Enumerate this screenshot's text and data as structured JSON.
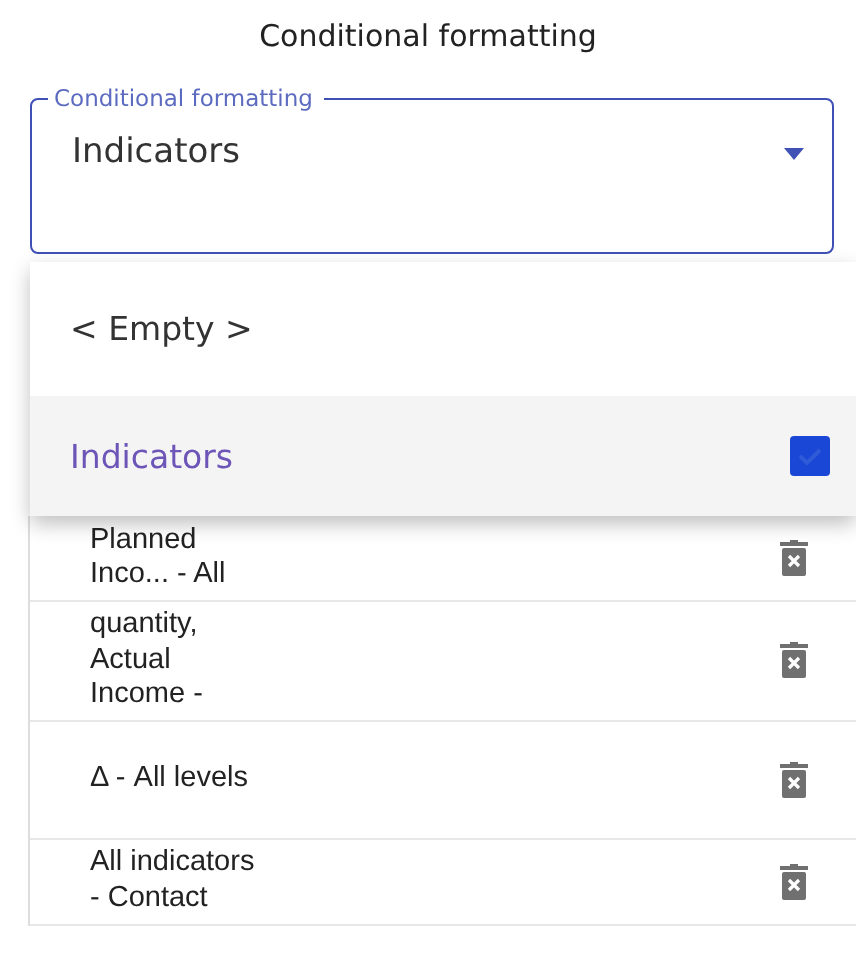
{
  "title": "Conditional formatting",
  "select": {
    "label": "Conditional formatting",
    "value": "Indicators",
    "expanded": true
  },
  "options": [
    {
      "label": "< Empty >",
      "selected": false
    },
    {
      "label": "Indicators",
      "selected": true
    }
  ],
  "rules": [
    {
      "text": "Planned Inco... - All"
    },
    {
      "text": "quantity, Actual Income -"
    },
    {
      "text": "Δ - All levels"
    },
    {
      "text": "All indicators - Contact"
    }
  ]
}
